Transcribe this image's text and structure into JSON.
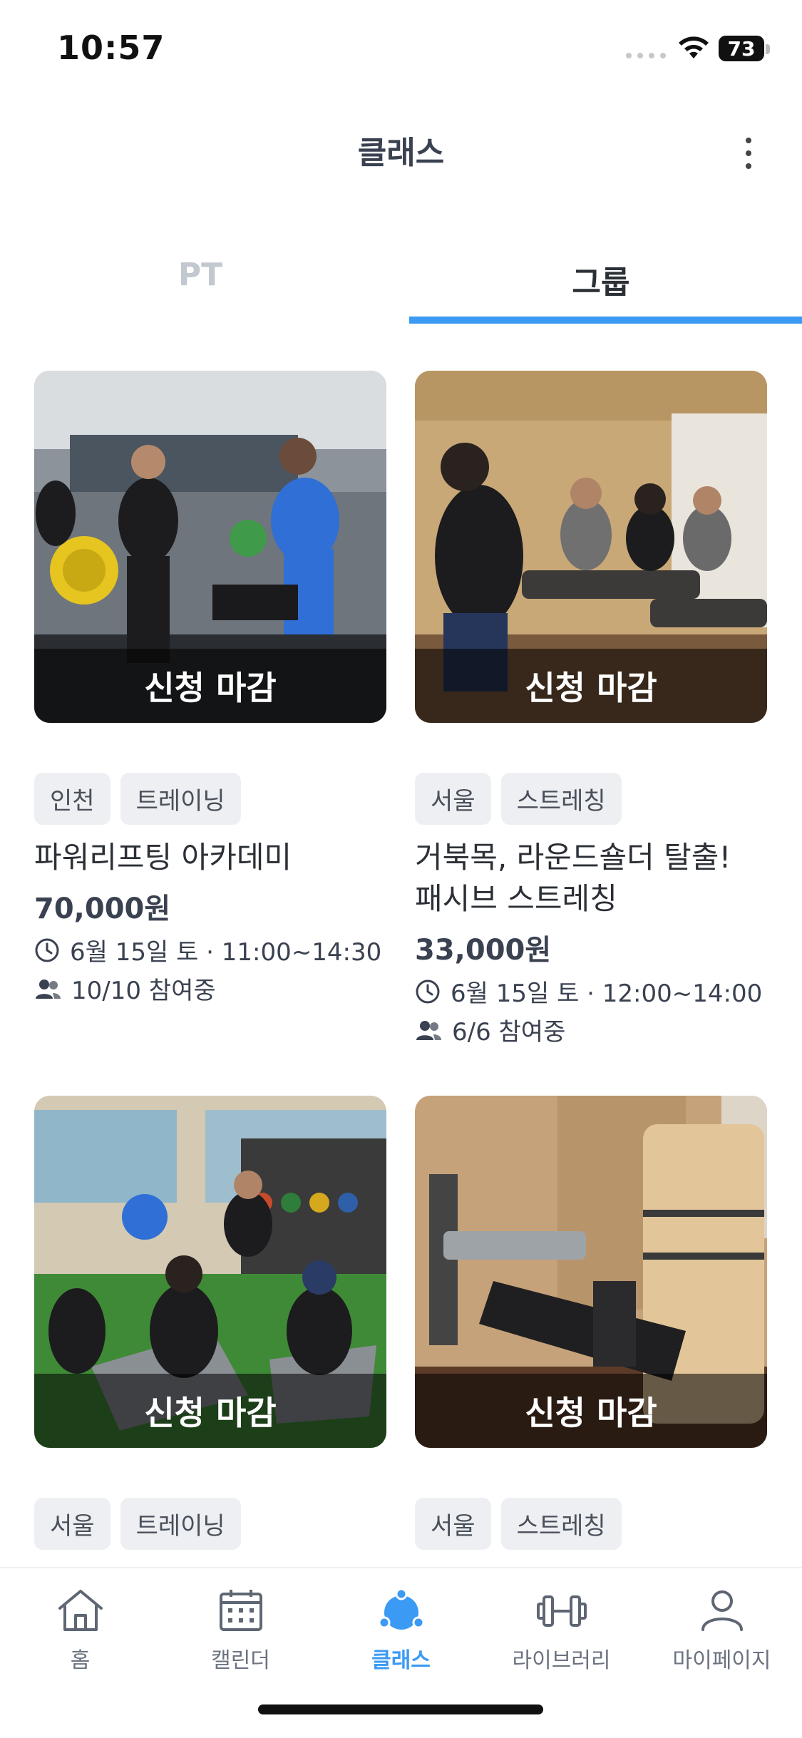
{
  "status_bar": {
    "time": "10:57",
    "battery": "73"
  },
  "header": {
    "title": "클래스"
  },
  "tabs": [
    {
      "label": "PT"
    },
    {
      "label": "그룹"
    }
  ],
  "cards": [
    {
      "status": "신청 마감",
      "tags": [
        "인천",
        "트레이닝"
      ],
      "title": "파워리프팅 아카데미",
      "price": "70,000원",
      "schedule": "6월 15일 토 · 11:00~14:30",
      "participants": "10/10 참여중"
    },
    {
      "status": "신청 마감",
      "tags": [
        "서울",
        "스트레칭"
      ],
      "title": "거북목, 라운드숄더 탈출! 패시브 스트레칭",
      "price": "33,000원",
      "schedule": "6월 15일 토 · 12:00~14:00",
      "participants": "6/6 참여중"
    },
    {
      "status": "신청 마감",
      "tags": [
        "서울",
        "트레이닝"
      ]
    },
    {
      "status": "신청 마감",
      "tags": [
        "서울",
        "스트레칭"
      ]
    }
  ],
  "bottom_nav": [
    {
      "label": "홈",
      "icon": "home-icon"
    },
    {
      "label": "캘린더",
      "icon": "calendar-icon"
    },
    {
      "label": "클래스",
      "icon": "class-icon",
      "active": true
    },
    {
      "label": "라이브러리",
      "icon": "dumbbell-icon"
    },
    {
      "label": "마이페이지",
      "icon": "person-icon"
    }
  ],
  "colors": {
    "accent": "#3b9af3",
    "text": "#2b2f36",
    "tag_bg": "#edeff2",
    "muted_tab": "#c3c8d0"
  }
}
